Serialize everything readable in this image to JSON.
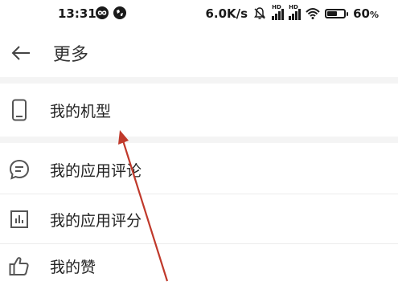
{
  "status_bar": {
    "time": "13:31",
    "net_speed": "6.0K/s",
    "hd_label": "HD",
    "battery_percent": "60",
    "battery_suffix": "%",
    "battery_level": 0.6
  },
  "header": {
    "back_icon": "arrow-left-icon",
    "title": "更多"
  },
  "menu": {
    "items": [
      {
        "label": "我的机型",
        "icon": "phone-icon"
      },
      {
        "label": "我的应用评论",
        "icon": "comment-icon"
      },
      {
        "label": "我的应用评分",
        "icon": "bar-chart-icon"
      },
      {
        "label": "我的赞",
        "icon": "thumbs-up-icon"
      }
    ]
  },
  "colors": {
    "annotation_arrow": "#c0392b",
    "separator": "#f4f4f4",
    "icon": "#555555"
  }
}
